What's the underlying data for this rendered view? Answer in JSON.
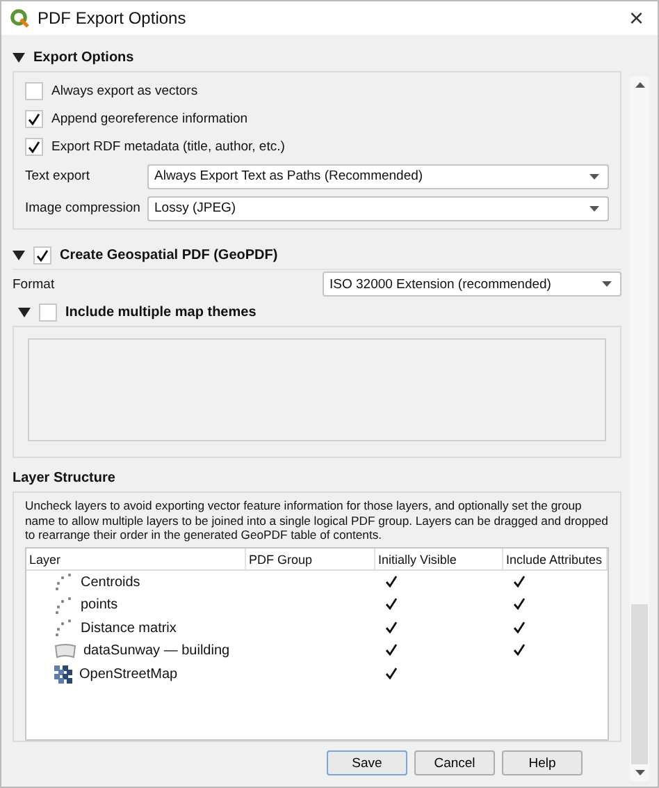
{
  "window": {
    "title": "PDF Export Options",
    "close": "×"
  },
  "export_options": {
    "title": "Export Options",
    "expanded": true,
    "checkboxes": [
      {
        "label": "Always export as vectors",
        "checked": false
      },
      {
        "label": "Append georeference information",
        "checked": true
      },
      {
        "label": "Export RDF metadata (title, author, etc.)",
        "checked": true
      }
    ],
    "fields": [
      {
        "label": "Text export",
        "value": "Always Export Text as Paths (Recommended)"
      },
      {
        "label": "Image compression",
        "value": "Lossy (JPEG)"
      }
    ]
  },
  "geopdf": {
    "title": "Create Geospatial PDF (GeoPDF)",
    "expanded": true,
    "checked": true,
    "format": {
      "label": "Format",
      "value": "ISO 32000 Extension (recommended)"
    },
    "themes": {
      "title": "Include multiple map themes",
      "expanded": true,
      "checked": false
    }
  },
  "layer_structure": {
    "title": "Layer Structure",
    "description": "Uncheck layers to avoid exporting vector feature information for those layers, and optionally set the group name to allow multiple layers to be joined into a single logical PDF group. Layers can be dragged and dropped to rearrange their order in the generated GeoPDF table of contents.",
    "columns": [
      "Layer",
      "PDF Group",
      "Initially Visible",
      "Include Attributes"
    ],
    "rows": [
      {
        "kind": "point",
        "name": "Centroids",
        "visible": true,
        "attributes": true
      },
      {
        "kind": "point",
        "name": "points",
        "visible": true,
        "attributes": true
      },
      {
        "kind": "point",
        "name": "Distance matrix",
        "visible": true,
        "attributes": true
      },
      {
        "kind": "polygon",
        "name": "dataSunway — building",
        "visible": true,
        "attributes": true
      },
      {
        "kind": "raster",
        "name": "OpenStreetMap",
        "visible": true
      }
    ]
  },
  "buttons": [
    "Save",
    "Cancel",
    "Help"
  ]
}
